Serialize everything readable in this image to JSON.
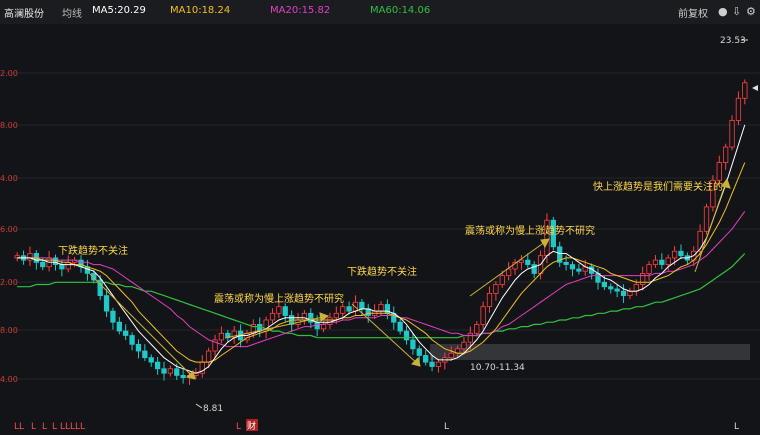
{
  "header": {
    "stock_name": "高澜股份",
    "line_type": "均线",
    "ma5": "MA5:20.29",
    "ma10": "MA10:18.24",
    "ma20": "MA20:15.82",
    "ma60": "MA60:14.06",
    "adjust": "前复权",
    "colors": {
      "ma5": "#ffffff",
      "ma10": "#f0c020",
      "ma20": "#e040c0",
      "ma60": "#30c040"
    },
    "icons": [
      "lock-icon",
      "download-icon",
      "settings-icon"
    ]
  },
  "chart_data": {
    "type": "candlestick",
    "y_ticks": [
      "2.00",
      "8.00",
      "4.00",
      "6.00",
      "2.00",
      "8.00",
      "4.00"
    ],
    "price_labels": {
      "high": "23.53",
      "low": "8.81",
      "range": "10.70-11.34"
    },
    "annotations": [
      {
        "text": "下跌趋势不关注"
      },
      {
        "text": "震荡或称为慢上涨趋势不研究"
      },
      {
        "text": "下跌趋势不关注"
      },
      {
        "text": "震荡或称为慢上涨趋势不研究"
      },
      {
        "text": "快上涨趋势是我们需要关注的"
      }
    ],
    "bottom_markers": [
      "LL",
      "L",
      "L",
      "L",
      "LLLL",
      "L",
      "L",
      "财",
      "L",
      "L"
    ],
    "close": [
      14.4,
      14.2,
      14.5,
      14.1,
      13.9,
      14.3,
      14.0,
      13.8,
      14.1,
      14.2,
      13.9,
      13.6,
      13.3,
      12.6,
      11.9,
      11.4,
      11.0,
      10.8,
      10.4,
      10.1,
      9.8,
      9.6,
      9.3,
      9.1,
      9.3,
      9.0,
      8.9,
      9.0,
      9.1,
      9.6,
      10.1,
      10.6,
      10.9,
      10.7,
      11.0,
      10.6,
      10.9,
      11.3,
      11.0,
      11.5,
      11.8,
      12.1,
      11.7,
      11.3,
      11.5,
      11.8,
      11.4,
      11.1,
      11.3,
      11.6,
      11.8,
      12.1,
      11.9,
      12.3,
      12.0,
      11.7,
      11.9,
      12.2,
      11.8,
      11.4,
      11.0,
      10.6,
      10.2,
      9.9,
      9.6,
      9.4,
      9.6,
      9.8,
      10.0,
      10.2,
      10.5,
      10.9,
      11.3,
      12.1,
      12.7,
      13.1,
      13.5,
      13.8,
      14.1,
      14.2,
      14.0,
      13.6,
      14.4,
      16.0,
      14.8,
      14.1,
      14.0,
      13.8,
      13.7,
      13.9,
      13.6,
      13.2,
      13.0,
      12.9,
      12.8,
      12.6,
      12.8,
      13.1,
      13.6,
      14.0,
      14.2,
      14.0,
      14.3,
      14.6,
      14.4,
      14.2,
      14.6,
      15.5,
      16.6,
      17.8,
      18.6,
      19.3,
      20.5,
      21.5,
      22.2
    ],
    "ma5": [
      14.3,
      14.3,
      14.3,
      14.2,
      14.2,
      14.1,
      14.1,
      14.0,
      14.0,
      14.0,
      13.9,
      13.8,
      13.7,
      13.4,
      13.0,
      12.6,
      12.2,
      11.8,
      11.4,
      11.0,
      10.7,
      10.4,
      10.1,
      9.8,
      9.6,
      9.4,
      9.3,
      9.2,
      9.1,
      9.2,
      9.4,
      9.8,
      10.2,
      10.5,
      10.7,
      10.8,
      10.8,
      10.9,
      11.0,
      11.1,
      11.3,
      11.5,
      11.6,
      11.6,
      11.6,
      11.6,
      11.5,
      11.4,
      11.4,
      11.4,
      11.5,
      11.6,
      11.8,
      11.9,
      12.0,
      12.0,
      11.9,
      11.9,
      11.9,
      11.8,
      11.6,
      11.3,
      10.9,
      10.5,
      10.2,
      9.9,
      9.7,
      9.7,
      9.7,
      9.8,
      10.0,
      10.3,
      10.6,
      11.0,
      11.5,
      12.0,
      12.5,
      12.9,
      13.3,
      13.6,
      13.8,
      13.9,
      14.0,
      14.4,
      14.6,
      14.5,
      14.5,
      14.3,
      14.1,
      13.9,
      13.8,
      13.6,
      13.4,
      13.3,
      13.1,
      12.9,
      12.8,
      12.8,
      12.9,
      13.1,
      13.4,
      13.6,
      13.9,
      14.1,
      14.3,
      14.3,
      14.4,
      14.7,
      15.2,
      16.0,
      16.8,
      17.6,
      18.5,
      19.4,
      20.3
    ],
    "ma10": [
      14.3,
      14.3,
      14.3,
      14.3,
      14.2,
      14.2,
      14.2,
      14.1,
      14.1,
      14.0,
      14.0,
      13.9,
      13.8,
      13.7,
      13.5,
      13.2,
      12.9,
      12.6,
      12.3,
      11.9,
      11.6,
      11.3,
      11.0,
      10.7,
      10.4,
      10.1,
      9.9,
      9.7,
      9.6,
      9.6,
      9.6,
      9.7,
      9.9,
      10.1,
      10.3,
      10.5,
      10.7,
      10.8,
      10.9,
      11.0,
      11.1,
      11.3,
      11.4,
      11.5,
      11.5,
      11.5,
      11.5,
      11.5,
      11.5,
      11.5,
      11.5,
      11.6,
      11.6,
      11.7,
      11.7,
      11.8,
      11.8,
      11.8,
      11.8,
      11.7,
      11.6,
      11.5,
      11.3,
      11.1,
      10.9,
      10.6,
      10.4,
      10.2,
      10.1,
      10.0,
      10.0,
      10.1,
      10.3,
      10.5,
      10.8,
      11.1,
      11.5,
      11.9,
      12.3,
      12.7,
      13.0,
      13.3,
      13.6,
      13.9,
      14.1,
      14.2,
      14.3,
      14.3,
      14.2,
      14.1,
      14.0,
      13.9,
      13.8,
      13.6,
      13.5,
      13.4,
      13.3,
      13.2,
      13.2,
      13.2,
      13.3,
      13.4,
      13.5,
      13.7,
      13.9,
      14.0,
      14.2,
      14.5,
      14.9,
      15.4,
      15.9,
      16.5,
      17.2,
      17.9,
      18.6
    ],
    "ma20": [
      14.3,
      14.3,
      14.3,
      14.3,
      14.3,
      14.3,
      14.2,
      14.2,
      14.2,
      14.2,
      14.1,
      14.1,
      14.0,
      14.0,
      13.9,
      13.8,
      13.6,
      13.4,
      13.2,
      13.0,
      12.8,
      12.6,
      12.4,
      12.2,
      12.0,
      11.7,
      11.5,
      11.2,
      11.0,
      10.8,
      10.6,
      10.5,
      10.4,
      10.3,
      10.3,
      10.3,
      10.3,
      10.4,
      10.5,
      10.6,
      10.7,
      10.8,
      10.9,
      11.0,
      11.1,
      11.2,
      11.2,
      11.3,
      11.3,
      11.4,
      11.4,
      11.5,
      11.5,
      11.6,
      11.6,
      11.6,
      11.6,
      11.7,
      11.7,
      11.7,
      11.6,
      11.6,
      11.5,
      11.4,
      11.3,
      11.2,
      11.1,
      11.0,
      10.9,
      10.9,
      10.8,
      10.8,
      10.8,
      10.9,
      10.9,
      11.0,
      11.2,
      11.3,
      11.5,
      11.7,
      11.9,
      12.1,
      12.3,
      12.5,
      12.7,
      12.9,
      13.1,
      13.2,
      13.3,
      13.4,
      13.5,
      13.5,
      13.5,
      13.5,
      13.5,
      13.5,
      13.5,
      13.5,
      13.5,
      13.5,
      13.6,
      13.6,
      13.7,
      13.7,
      13.8,
      13.9,
      14.0,
      14.2,
      14.4,
      14.7,
      15.0,
      15.3,
      15.6,
      16.0,
      16.4
    ],
    "ma60": [
      13.0,
      13.0,
      13.0,
      13.1,
      13.1,
      13.1,
      13.2,
      13.2,
      13.2,
      13.2,
      13.2,
      13.2,
      13.2,
      13.2,
      13.2,
      13.1,
      13.1,
      13.0,
      13.0,
      12.9,
      12.8,
      12.8,
      12.7,
      12.6,
      12.5,
      12.4,
      12.3,
      12.2,
      12.1,
      12.0,
      11.9,
      11.8,
      11.7,
      11.6,
      11.5,
      11.4,
      11.3,
      11.2,
      11.2,
      11.1,
      11.0,
      11.0,
      10.9,
      10.9,
      10.8,
      10.8,
      10.8,
      10.7,
      10.7,
      10.7,
      10.7,
      10.7,
      10.7,
      10.7,
      10.7,
      10.7,
      10.7,
      10.7,
      10.7,
      10.7,
      10.7,
      10.7,
      10.7,
      10.7,
      10.7,
      10.7,
      10.7,
      10.7,
      10.7,
      10.7,
      10.8,
      10.8,
      10.8,
      10.9,
      10.9,
      11.0,
      11.0,
      11.1,
      11.1,
      11.2,
      11.2,
      11.3,
      11.3,
      11.4,
      11.4,
      11.5,
      11.5,
      11.6,
      11.6,
      11.7,
      11.7,
      11.8,
      11.8,
      11.9,
      11.9,
      12.0,
      12.0,
      12.1,
      12.1,
      12.2,
      12.3,
      12.3,
      12.4,
      12.5,
      12.6,
      12.7,
      12.8,
      12.9,
      13.1,
      13.3,
      13.5,
      13.7,
      13.9,
      14.2,
      14.5
    ],
    "ylim": [
      7.8,
      24.4
    ]
  }
}
